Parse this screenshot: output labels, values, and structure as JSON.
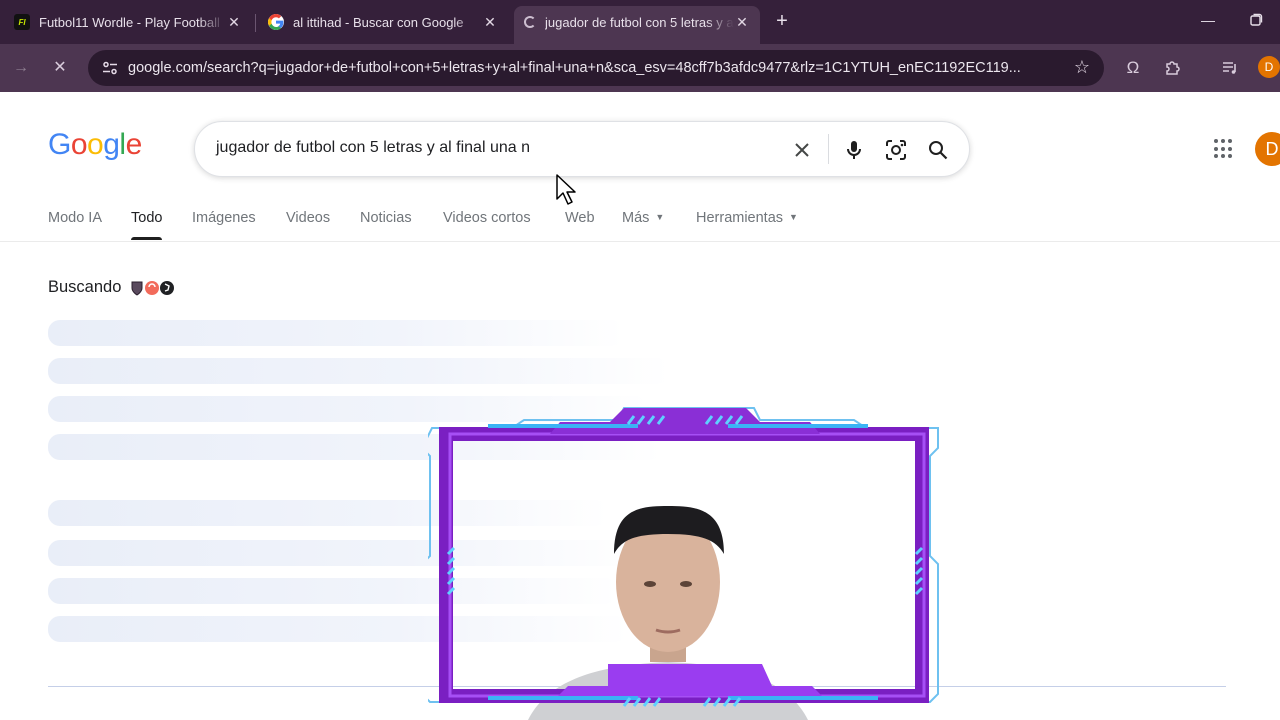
{
  "browser": {
    "tabs": [
      {
        "title": "Futbol11 Wordle - Play Football",
        "icon": "futbol11-icon",
        "active": false
      },
      {
        "title": "al ittihad - Buscar con Google",
        "icon": "google-g-icon",
        "active": false
      },
      {
        "title": "jugador de futbol con 5 letras y al final una n",
        "icon": "loading-spinner-icon",
        "active": true
      }
    ],
    "url": "google.com/search?q=jugador+de+futbol+con+5+letras+y+al+final+una+n&sca_esv=48cff7b3afdc9477&rlz=1C1YTUH_enEC1192EC119...",
    "profile_initial": "D",
    "accent": "#35203a"
  },
  "google": {
    "logo_text": "Google",
    "query": "jugador de futbol con 5 letras y al final una n",
    "nav_tabs": [
      "Modo IA",
      "Todo",
      "Imágenes",
      "Videos",
      "Noticias",
      "Videos cortos",
      "Web",
      "Más",
      "Herramientas"
    ],
    "active_tab": "Todo",
    "loading_text": "Buscando",
    "profile_initial": "D"
  }
}
